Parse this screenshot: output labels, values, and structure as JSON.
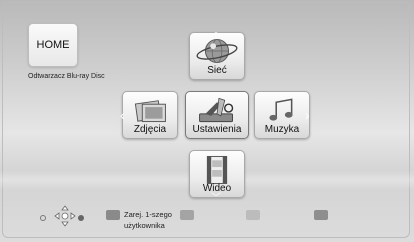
{
  "home": {
    "label": "HOME"
  },
  "player": {
    "name": "Odtwarzacz Blu-ray Disc"
  },
  "menu": {
    "network": {
      "label": "Sieć",
      "icon": "globe-icon"
    },
    "photos": {
      "label": "Zdjęcia",
      "icon": "photos-icon"
    },
    "settings": {
      "label": "Ustawienia",
      "icon": "tools-icon"
    },
    "music": {
      "label": "Muzyka",
      "icon": "music-note-icon"
    },
    "video": {
      "label": "Wideo",
      "icon": "film-strip-icon"
    }
  },
  "color_buttons": {
    "red": {
      "label_line1": "Zarej. 1-szego",
      "label_line2": "użytkownika",
      "color": "#8a8a8a"
    },
    "green": {
      "color": "#a4a4a4"
    },
    "yellow": {
      "color": "#bcbcbc"
    },
    "blue": {
      "color": "#8e8e8e"
    }
  }
}
